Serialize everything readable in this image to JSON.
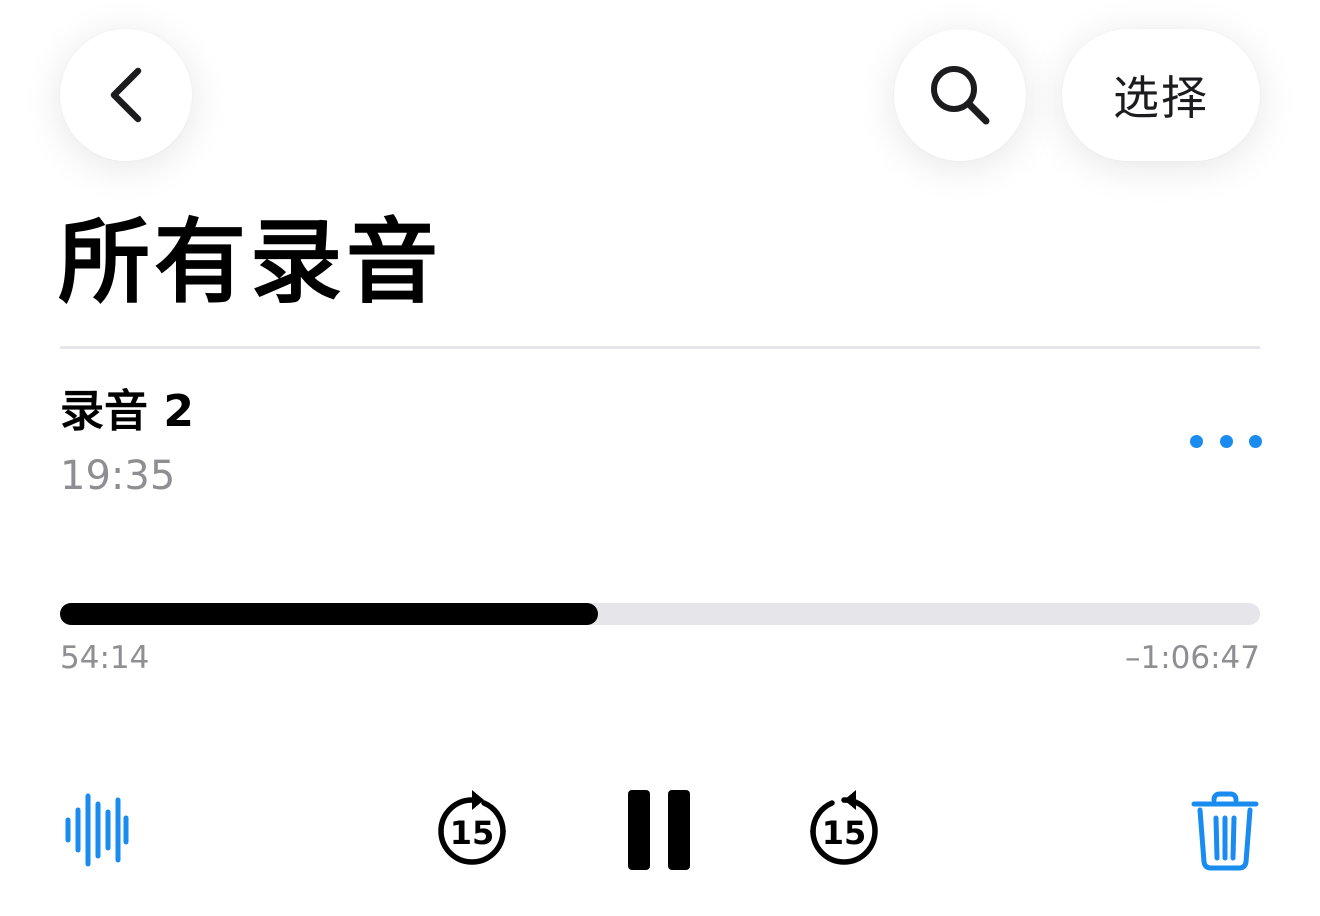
{
  "header": {
    "back_icon": "chevron-left-icon",
    "search_icon": "magnifying-glass-icon",
    "select_label": "选择"
  },
  "page_title": "所有录音",
  "recording": {
    "title": "录音 2",
    "time": "19:35",
    "more_icon": "ellipsis-icon"
  },
  "playback": {
    "progress": 0.448,
    "elapsed": "54:14",
    "remaining": "–1:06:47"
  },
  "controls": {
    "waveform_icon": "waveform-icon",
    "rewind_label": "15",
    "pause_icon": "pause-icon",
    "forward_label": "15",
    "trash_icon": "trash-icon"
  },
  "colors": {
    "accent": "#1a8cf0",
    "secondary_text": "#8e8e93",
    "track": "#e5e5ea"
  }
}
